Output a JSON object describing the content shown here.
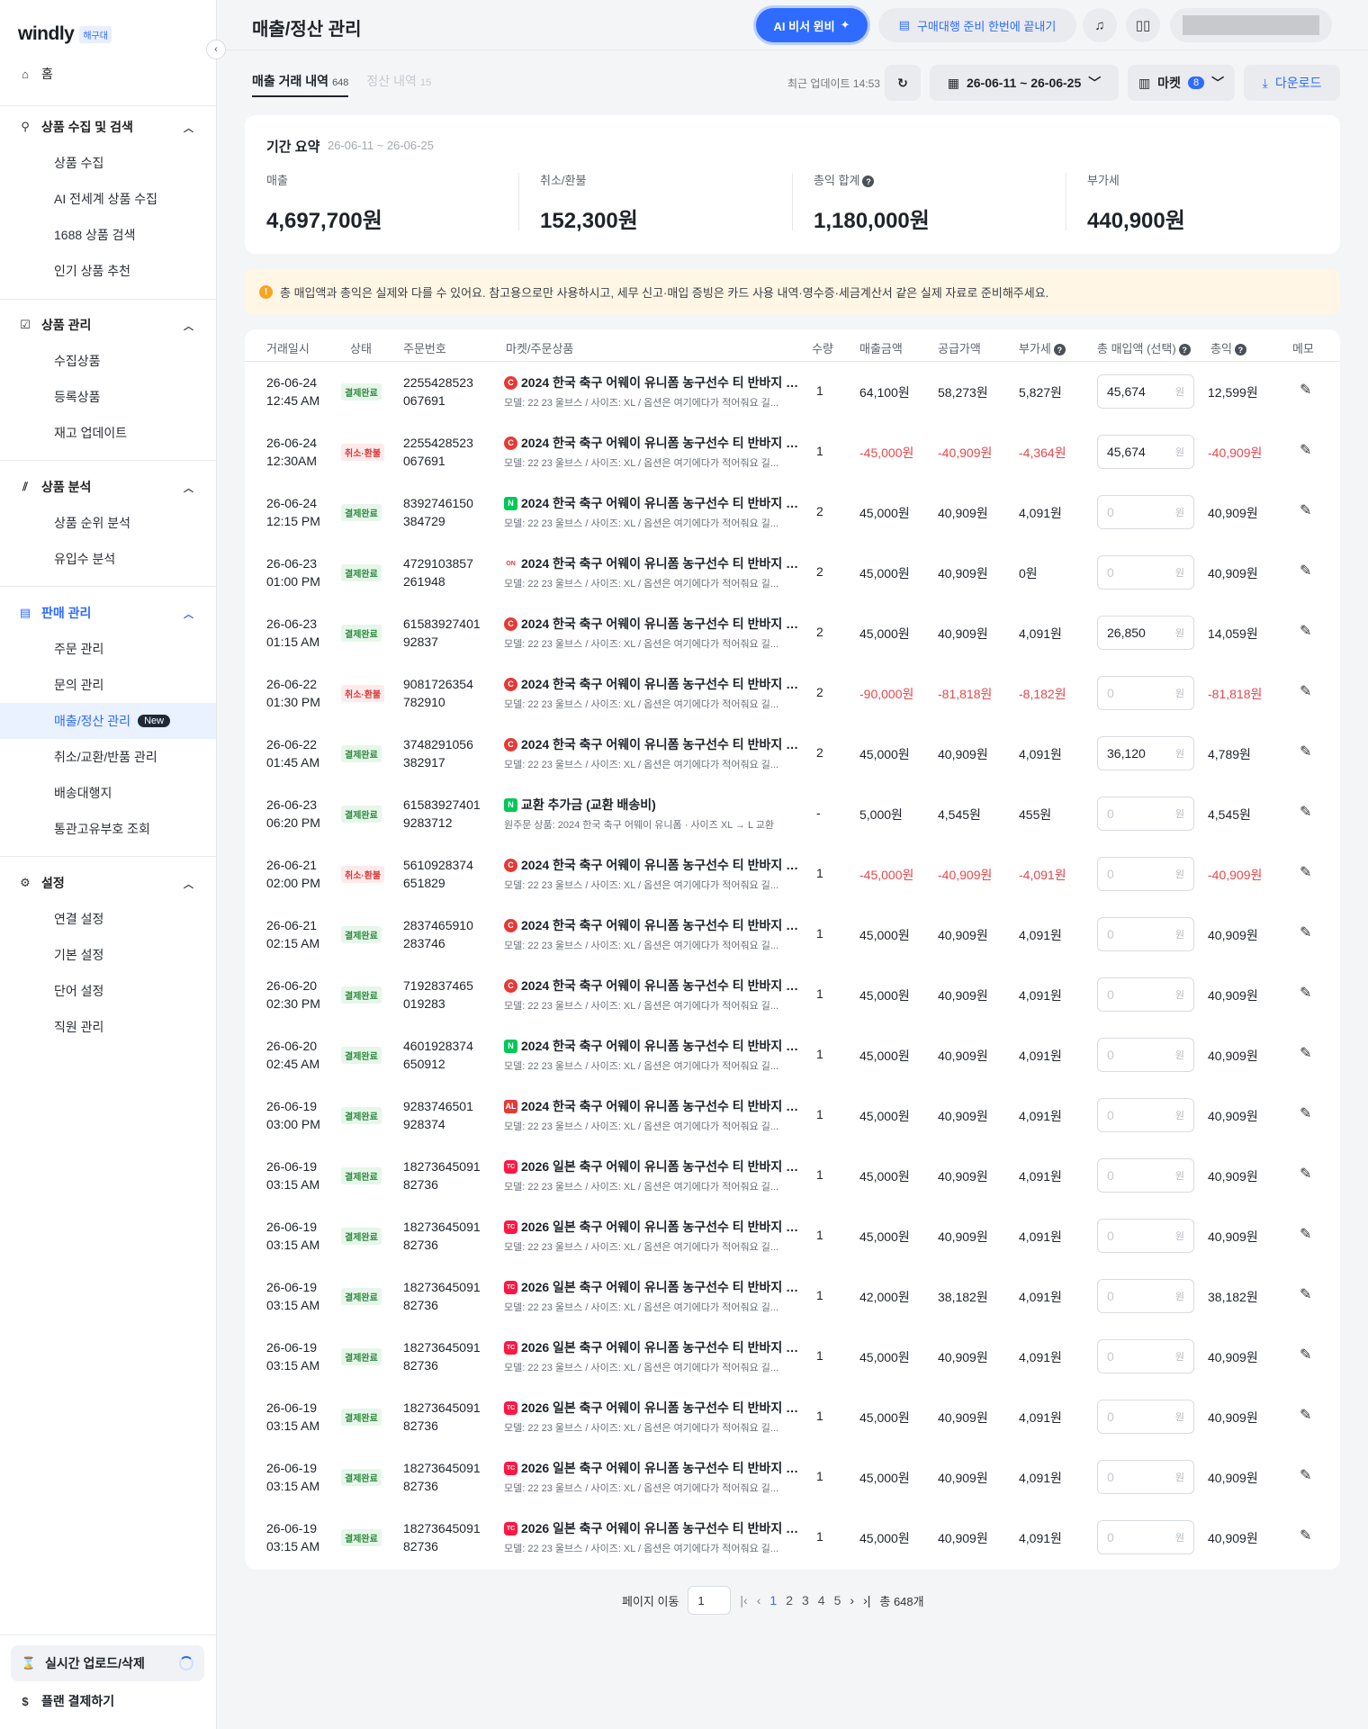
{
  "sidebar": {
    "logo": "windly",
    "logo_badge": "해구대",
    "home": "홈",
    "groups": [
      {
        "title": "상품 수집 및 검색",
        "items": [
          "상품 수집",
          "AI 전세계 상품 수집",
          "1688 상품 검색",
          "인기 상품 추천"
        ]
      },
      {
        "title": "상품 관리",
        "items": [
          "수집상품",
          "등록상품",
          "재고 업데이트"
        ]
      },
      {
        "title": "상품 분석",
        "items": [
          "상품 순위 분석",
          "유입수 분석"
        ]
      },
      {
        "title": "판매 관리",
        "items": [
          "주문 관리",
          "문의 관리",
          "매출/정산 관리",
          "취소/교환/반품 관리",
          "배송대행지",
          "통관고유부호 조회"
        ]
      },
      {
        "title": "설정",
        "items": [
          "연결 설정",
          "기본 설정",
          "단어 설정",
          "직원 관리"
        ]
      }
    ],
    "new_badge": "New",
    "realtime": "실시간 업로드/삭제",
    "plan": "플랜 결제하기"
  },
  "header": {
    "title": "매출/정산 관리",
    "ai_button": "AI 비서 윈비",
    "prep_button": "구매대행 준비 한번에 끝내기"
  },
  "tabs": [
    {
      "label": "매출 거래 내역",
      "count": "648"
    },
    {
      "label": "정산 내역",
      "count": "15"
    }
  ],
  "toolbar": {
    "updated": "최근 업데이트 14:53",
    "date_range": "26-06-11 ~ 26-06-25",
    "market_label": "마켓",
    "market_count": "8",
    "download": "다운로드"
  },
  "summary": {
    "title": "기간 요약",
    "range": "26-06-11 ~ 26-06-25",
    "stats": [
      {
        "label": "매출",
        "value": "4,697,700원"
      },
      {
        "label": "취소/환불",
        "value": "152,300원"
      },
      {
        "label": "총익 합계",
        "value": "1,180,000원"
      },
      {
        "label": "부가세",
        "value": "440,900원"
      }
    ]
  },
  "notice": "총 매입액과 총익은 실제와 다를 수 있어요. 참고용으로만 사용하시고, 세무 신고·매입 증빙은 카드 사용 내역·영수증·세금계산서 같은 실제 자료로 준비해주세요.",
  "table": {
    "headers": [
      "거래일시",
      "상태",
      "주문번호",
      "마켓/주문상품",
      "수량",
      "매출금액",
      "공급가액",
      "부가세",
      "총 매입액 (선택)",
      "총익",
      "메모"
    ],
    "unit": "원",
    "rows": [
      {
        "date": "26-06-24",
        "time": "12:45 AM",
        "status": "결제완료",
        "kind": "ok",
        "order1": "2255428523",
        "order2": "067691",
        "market": "C",
        "product": "2024 한국 축구 어웨이 유니폼 농구선수 티 반바지 세...",
        "detail": "모델: 22 23 울브스 / 사이즈: XL / 옵션은 여기에다가 적어줘요 길...",
        "qty": "1",
        "sales": "64,100원",
        "supply": "58,273원",
        "vat": "5,827원",
        "cost": "45,674",
        "profit": "12,599원"
      },
      {
        "date": "26-06-24",
        "time": "12:30AM",
        "status": "취소·환불",
        "kind": "cancel",
        "order1": "2255428523",
        "order2": "067691",
        "market": "C",
        "product": "2024 한국 축구 어웨이 유니폼 농구선수 티 반바지 세...",
        "detail": "모델: 22 23 울브스 / 사이즈: XL / 옵션은 여기에다가 적어줘요 길...",
        "qty": "1",
        "sales": "-45,000원",
        "supply": "-40,909원",
        "vat": "-4,364원",
        "cost": "45,674",
        "profit": "-40,909원"
      },
      {
        "date": "26-06-24",
        "time": "12:15 PM",
        "status": "결제완료",
        "kind": "ok",
        "order1": "8392746150",
        "order2": "384729",
        "market": "N",
        "product": "2024 한국 축구 어웨이 유니폼 농구선수 티 반바지 세...",
        "detail": "모델: 22 23 울브스 / 사이즈: XL / 옵션은 여기에다가 적어줘요 길...",
        "qty": "2",
        "sales": "45,000원",
        "supply": "40,909원",
        "vat": "4,091원",
        "cost": "0",
        "profit": "40,909원"
      },
      {
        "date": "26-06-23",
        "time": "01:00 PM",
        "status": "결제완료",
        "kind": "ok",
        "order1": "4729103857",
        "order2": "261948",
        "market": "ON",
        "product": "2024 한국 축구 어웨이 유니폼 농구선수 티 반바지 세...",
        "detail": "모델: 22 23 울브스 / 사이즈: XL / 옵션은 여기에다가 적어줘요 길...",
        "qty": "2",
        "sales": "45,000원",
        "supply": "40,909원",
        "vat": "0원",
        "cost": "0",
        "profit": "40,909원"
      },
      {
        "date": "26-06-23",
        "time": "01:15 AM",
        "status": "결제완료",
        "kind": "ok",
        "order1": "61583927401",
        "order2": "92837",
        "market": "C",
        "product": "2024 한국 축구 어웨이 유니폼 농구선수 티 반바지 세...",
        "detail": "모델: 22 23 울브스 / 사이즈: XL / 옵션은 여기에다가 적어줘요 길...",
        "qty": "2",
        "sales": "45,000원",
        "supply": "40,909원",
        "vat": "4,091원",
        "cost": "26,850",
        "profit": "14,059원"
      },
      {
        "date": "26-06-22",
        "time": "01:30 PM",
        "status": "취소·환불",
        "kind": "cancel",
        "order1": "9081726354",
        "order2": "782910",
        "market": "C",
        "product": "2024 한국 축구 어웨이 유니폼 농구선수 티 반바지 세...",
        "detail": "모델: 22 23 울브스 / 사이즈: XL / 옵션은 여기에다가 적어줘요 길...",
        "qty": "2",
        "sales": "-90,000원",
        "supply": "-81,818원",
        "vat": "-8,182원",
        "cost": "0",
        "profit": "-81,818원"
      },
      {
        "date": "26-06-22",
        "time": "01:45 AM",
        "status": "결제완료",
        "kind": "ok",
        "order1": "3748291056",
        "order2": "382917",
        "market": "C",
        "product": "2024 한국 축구 어웨이 유니폼 농구선수 티 반바지 세...",
        "detail": "모델: 22 23 울브스 / 사이즈: XL / 옵션은 여기에다가 적어줘요 길...",
        "qty": "2",
        "sales": "45,000원",
        "supply": "40,909원",
        "vat": "4,091원",
        "cost": "36,120",
        "profit": "4,789원"
      },
      {
        "date": "26-06-23",
        "time": "06:20 PM",
        "status": "결제완료",
        "kind": "ok",
        "order1": "61583927401",
        "order2": "9283712",
        "market": "N",
        "product": "교환 추가금 (교환 배송비)",
        "detail": "원주문 상품: 2024 한국 축구 어웨이 유니폼 · 사이즈 XL → L 교환",
        "qty": "-",
        "sales": "5,000원",
        "supply": "4,545원",
        "vat": "455원",
        "cost": "0",
        "profit": "4,545원"
      },
      {
        "date": "26-06-21",
        "time": "02:00 PM",
        "status": "취소·환불",
        "kind": "cancel",
        "order1": "5610928374",
        "order2": "651829",
        "market": "C",
        "product": "2024 한국 축구 어웨이 유니폼 농구선수 티 반바지 세...",
        "detail": "모델: 22 23 울브스 / 사이즈: XL / 옵션은 여기에다가 적어줘요 길...",
        "qty": "1",
        "sales": "-45,000원",
        "supply": "-40,909원",
        "vat": "-4,091원",
        "cost": "0",
        "profit": "-40,909원"
      },
      {
        "date": "26-06-21",
        "time": "02:15 AM",
        "status": "결제완료",
        "kind": "ok",
        "order1": "2837465910",
        "order2": "283746",
        "market": "C",
        "product": "2024 한국 축구 어웨이 유니폼 농구선수 티 반바지 세...",
        "detail": "모델: 22 23 울브스 / 사이즈: XL / 옵션은 여기에다가 적어줘요 길...",
        "qty": "1",
        "sales": "45,000원",
        "supply": "40,909원",
        "vat": "4,091원",
        "cost": "0",
        "profit": "40,909원"
      },
      {
        "date": "26-06-20",
        "time": "02:30 PM",
        "status": "결제완료",
        "kind": "ok",
        "order1": "7192837465",
        "order2": "019283",
        "market": "C",
        "product": "2024 한국 축구 어웨이 유니폼 농구선수 티 반바지 세...",
        "detail": "모델: 22 23 울브스 / 사이즈: XL / 옵션은 여기에다가 적어줘요 길...",
        "qty": "1",
        "sales": "45,000원",
        "supply": "40,909원",
        "vat": "4,091원",
        "cost": "0",
        "profit": "40,909원"
      },
      {
        "date": "26-06-20",
        "time": "02:45 AM",
        "status": "결제완료",
        "kind": "ok",
        "order1": "4601928374",
        "order2": "650912",
        "market": "N",
        "product": "2024 한국 축구 어웨이 유니폼 농구선수 티 반바지 세...",
        "detail": "모델: 22 23 울브스 / 사이즈: XL / 옵션은 여기에다가 적어줘요 길...",
        "qty": "1",
        "sales": "45,000원",
        "supply": "40,909원",
        "vat": "4,091원",
        "cost": "0",
        "profit": "40,909원"
      },
      {
        "date": "26-06-19",
        "time": "03:00 PM",
        "status": "결제완료",
        "kind": "ok",
        "order1": "9283746501",
        "order2": "928374",
        "market": "AL",
        "product": "2024 한국 축구 어웨이 유니폼 농구선수 티 반바지 세...",
        "detail": "모델: 22 23 울브스 / 사이즈: XL / 옵션은 여기에다가 적어줘요 길...",
        "qty": "1",
        "sales": "45,000원",
        "supply": "40,909원",
        "vat": "4,091원",
        "cost": "0",
        "profit": "40,909원"
      },
      {
        "date": "26-06-19",
        "time": "03:15 AM",
        "status": "결제완료",
        "kind": "ok",
        "order1": "18273645091",
        "order2": "82736",
        "market": "TC",
        "product": "2026 일본 축구 어웨이 유니폼 농구선수 티 반바지 세...",
        "detail": "모델: 22 23 울브스 / 사이즈: XL / 옵션은 여기에다가 적어줘요 길...",
        "qty": "1",
        "sales": "45,000원",
        "supply": "40,909원",
        "vat": "4,091원",
        "cost": "0",
        "profit": "40,909원"
      },
      {
        "date": "26-06-19",
        "time": "03:15 AM",
        "status": "결제완료",
        "kind": "ok",
        "order1": "18273645091",
        "order2": "82736",
        "market": "TC",
        "product": "2026 일본 축구 어웨이 유니폼 농구선수 티 반바지 세...",
        "detail": "모델: 22 23 울브스 / 사이즈: XL / 옵션은 여기에다가 적어줘요 길...",
        "qty": "1",
        "sales": "45,000원",
        "supply": "40,909원",
        "vat": "4,091원",
        "cost": "0",
        "profit": "40,909원"
      },
      {
        "date": "26-06-19",
        "time": "03:15 AM",
        "status": "결제완료",
        "kind": "ok",
        "order1": "18273645091",
        "order2": "82736",
        "market": "TC",
        "product": "2026 일본 축구 어웨이 유니폼 농구선수 티 반바지 세...",
        "detail": "모델: 22 23 울브스 / 사이즈: XL / 옵션은 여기에다가 적어줘요 길...",
        "qty": "1",
        "sales": "42,000원",
        "supply": "38,182원",
        "vat": "4,091원",
        "cost": "0",
        "profit": "38,182원"
      },
      {
        "date": "26-06-19",
        "time": "03:15 AM",
        "status": "결제완료",
        "kind": "ok",
        "order1": "18273645091",
        "order2": "82736",
        "market": "TC",
        "product": "2026 일본 축구 어웨이 유니폼 농구선수 티 반바지 세...",
        "detail": "모델: 22 23 울브스 / 사이즈: XL / 옵션은 여기에다가 적어줘요 길...",
        "qty": "1",
        "sales": "45,000원",
        "supply": "40,909원",
        "vat": "4,091원",
        "cost": "0",
        "profit": "40,909원"
      },
      {
        "date": "26-06-19",
        "time": "03:15 AM",
        "status": "결제완료",
        "kind": "ok",
        "order1": "18273645091",
        "order2": "82736",
        "market": "TC",
        "product": "2026 일본 축구 어웨이 유니폼 농구선수 티 반바지 세...",
        "detail": "모델: 22 23 울브스 / 사이즈: XL / 옵션은 여기에다가 적어줘요 길...",
        "qty": "1",
        "sales": "45,000원",
        "supply": "40,909원",
        "vat": "4,091원",
        "cost": "0",
        "profit": "40,909원"
      },
      {
        "date": "26-06-19",
        "time": "03:15 AM",
        "status": "결제완료",
        "kind": "ok",
        "order1": "18273645091",
        "order2": "82736",
        "market": "TC",
        "product": "2026 일본 축구 어웨이 유니폼 농구선수 티 반바지 세...",
        "detail": "모델: 22 23 울브스 / 사이즈: XL / 옵션은 여기에다가 적어줘요 길...",
        "qty": "1",
        "sales": "45,000원",
        "supply": "40,909원",
        "vat": "4,091원",
        "cost": "0",
        "profit": "40,909원"
      },
      {
        "date": "26-06-19",
        "time": "03:15 AM",
        "status": "결제완료",
        "kind": "ok",
        "order1": "18273645091",
        "order2": "82736",
        "market": "TC",
        "product": "2026 일본 축구 어웨이 유니폼 농구선수 티 반바지 세...",
        "detail": "모델: 22 23 울브스 / 사이즈: XL / 옵션은 여기에다가 적어줘요 길...",
        "qty": "1",
        "sales": "45,000원",
        "supply": "40,909원",
        "vat": "4,091원",
        "cost": "0",
        "profit": "40,909원"
      }
    ]
  },
  "pagination": {
    "label": "페이지 이동",
    "input_value": "1",
    "pages": [
      "1",
      "2",
      "3",
      "4",
      "5"
    ],
    "current": "1",
    "total": "총 648개"
  }
}
